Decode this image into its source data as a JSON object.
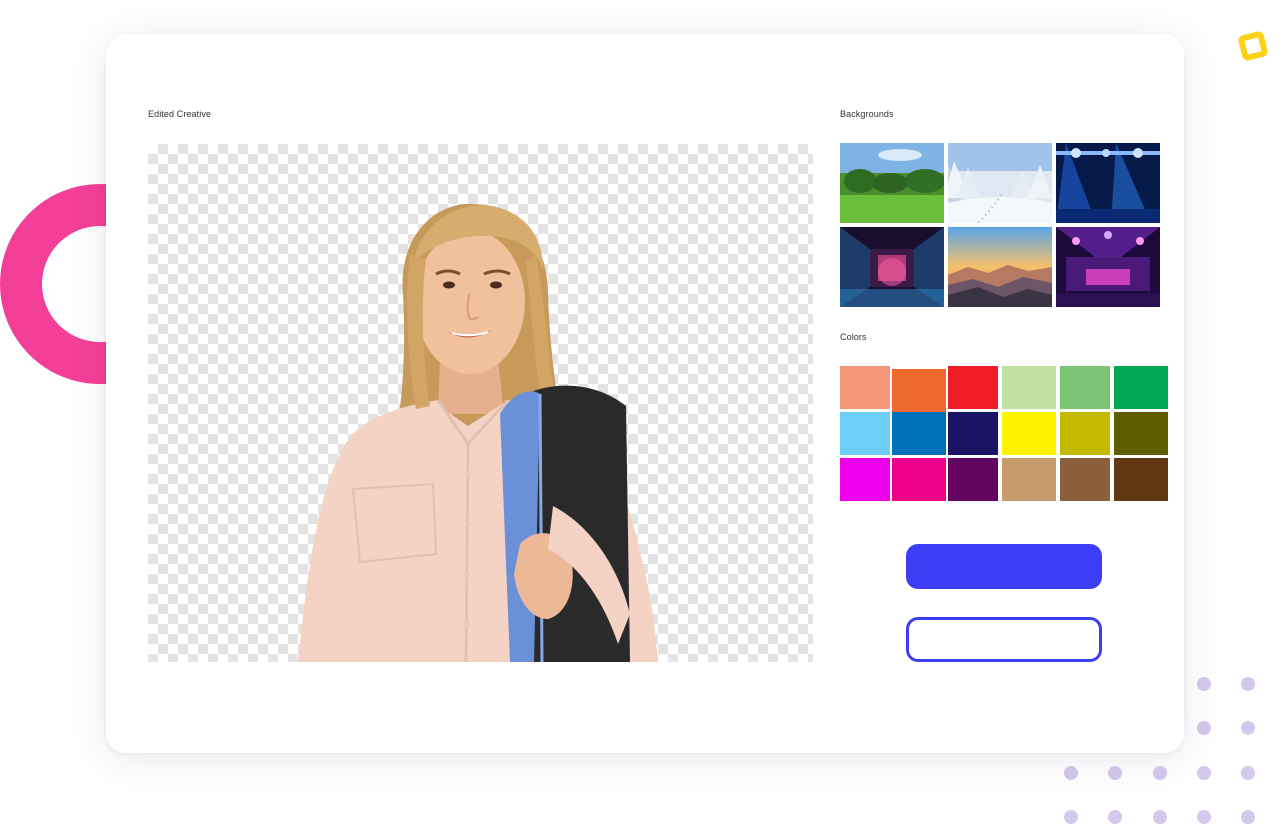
{
  "editor": {
    "canvas_label": "Edited Creative",
    "backgrounds_label": "Backgrounds",
    "colors_label": "Colors"
  },
  "backgrounds": [
    {
      "name": "green-field-background",
      "label": ""
    },
    {
      "name": "snowy-forest-background",
      "label": ""
    },
    {
      "name": "blue-stage-lights-background",
      "label": ""
    },
    {
      "name": "neon-hall-background",
      "label": ""
    },
    {
      "name": "sunset-mountains-background",
      "label": ""
    },
    {
      "name": "purple-concert-hall-background",
      "label": ""
    }
  ],
  "colors": [
    "#f59779",
    "#f0692c",
    "#ee1c25",
    "#c2e09f",
    "#7cc576",
    "#00a651",
    "#6dcff6",
    "#0072bc",
    "#1b1464",
    "#fff200",
    "#c4bb00",
    "#5e5e00",
    "#ec00ec",
    "#ec008c",
    "#630460",
    "#c69c6d",
    "#8b5e3c",
    "#603913"
  ],
  "actions": {
    "primary_label": "",
    "secondary_label": ""
  },
  "theme": {
    "accent": "#3d3df5",
    "decor_pink": "#f43f98",
    "decor_yellow": "#fcd116",
    "decor_dots": "#d4c8ec"
  }
}
